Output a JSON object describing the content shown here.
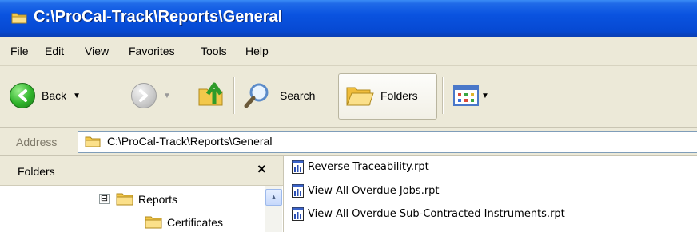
{
  "window": {
    "title": "C:\\ProCal-Track\\Reports\\General",
    "title_icon": "folder-icon"
  },
  "menu": {
    "items": [
      "File",
      "Edit",
      "View",
      "Favorites",
      "Tools",
      "Help"
    ]
  },
  "toolbar": {
    "back_label": "Back",
    "search_label": "Search",
    "folders_label": "Folders",
    "icons": [
      "back-arrow-icon",
      "forward-arrow-icon",
      "up-folder-icon",
      "search-icon",
      "folders-icon",
      "views-icon"
    ]
  },
  "address": {
    "label": "Address",
    "value": "C:\\ProCal-Track\\Reports\\General"
  },
  "folders_pane": {
    "title": "Folders",
    "close_glyph": "×",
    "tree": [
      {
        "label": "Reports",
        "expander": "⊟"
      },
      {
        "label": "Certificates"
      }
    ]
  },
  "files": [
    {
      "name": "Reverse Traceability.rpt",
      "icon": "report-file-icon"
    },
    {
      "name": "View All Overdue Jobs.rpt",
      "icon": "report-file-icon"
    },
    {
      "name": "View All Overdue Sub-Contracted Instruments.rpt",
      "icon": "report-file-icon"
    }
  ],
  "colors": {
    "titlebar": "#0a53e0",
    "chrome": "#ece9d8",
    "folder_yellow": "#f3c84b"
  }
}
